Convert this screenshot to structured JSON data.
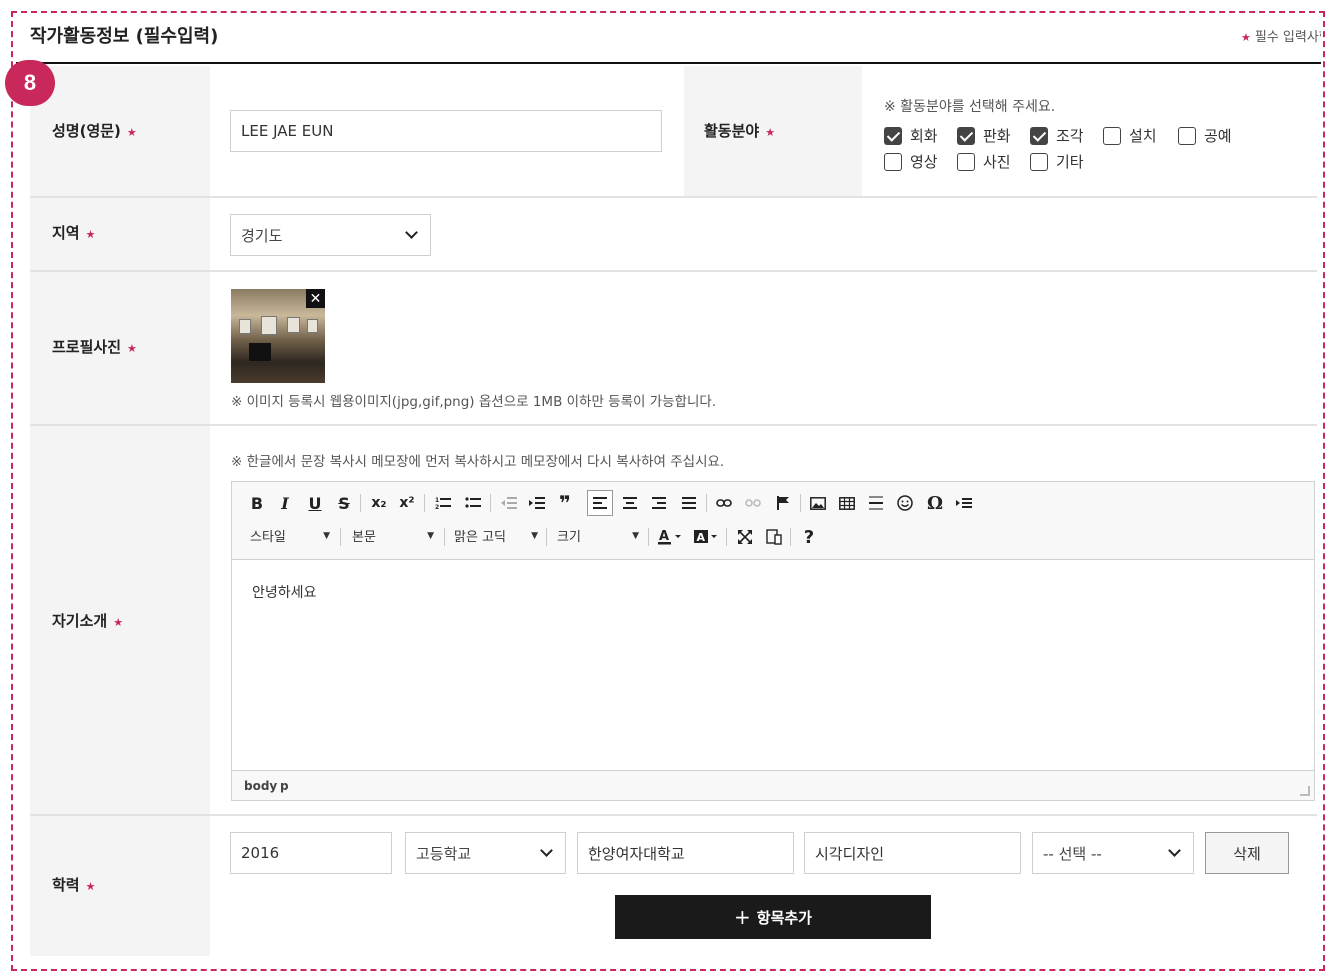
{
  "section": {
    "title": "작가활동정보 (필수입력)",
    "required_note": "필수 입력사항"
  },
  "step_badge": "8",
  "name": {
    "label": "성명(영문)",
    "value": "LEE JAE EUN"
  },
  "activity": {
    "label": "활동분야",
    "hint": "※ 활동분야를 선택해 주세요.",
    "options": [
      {
        "label": "회화",
        "checked": true
      },
      {
        "label": "판화",
        "checked": true
      },
      {
        "label": "조각",
        "checked": true
      },
      {
        "label": "설치",
        "checked": false
      },
      {
        "label": "공예",
        "checked": false
      },
      {
        "label": "영상",
        "checked": false
      },
      {
        "label": "사진",
        "checked": false
      },
      {
        "label": "기타",
        "checked": false
      }
    ]
  },
  "region": {
    "label": "지역",
    "value": "경기도"
  },
  "profile_photo": {
    "label": "프로필사진",
    "close": "✕",
    "note": "※ 이미지 등록시 웹용이미지(jpg,gif,png) 옵션으로 1MB 이하만 등록이 가능합니다."
  },
  "intro": {
    "label": "자기소개",
    "hint": "※ 한글에서 문장 복사시 메모장에 먼저 복사하시고 메모장에서 다시 복사하여 주십시요.",
    "toolbar": {
      "bold": "B",
      "italic": "I",
      "underline": "U",
      "strike": "S",
      "subscript": "x₂",
      "superscript": "x²",
      "style_label": "스타일",
      "format_label": "본문",
      "font_label": "맑은 고딕",
      "size_label": "크기",
      "help": "?",
      "special_char": "Ω",
      "quote": "❞",
      "dropdown_arrow": "▼"
    },
    "content": "안녕하세요",
    "status_path": [
      "body",
      "p"
    ]
  },
  "education": {
    "label": "학력",
    "year": "2016",
    "school_type": "고등학교",
    "school_name": "한양여자대학교",
    "major": "시각디자인",
    "status": "-- 선택 --",
    "delete_label": "삭제",
    "add_plus": "+",
    "add_label": "항목추가"
  },
  "colors": {
    "accent": "#c8285a",
    "header_bg": "#f4f4f4",
    "button_dark": "#1a1a1a"
  }
}
